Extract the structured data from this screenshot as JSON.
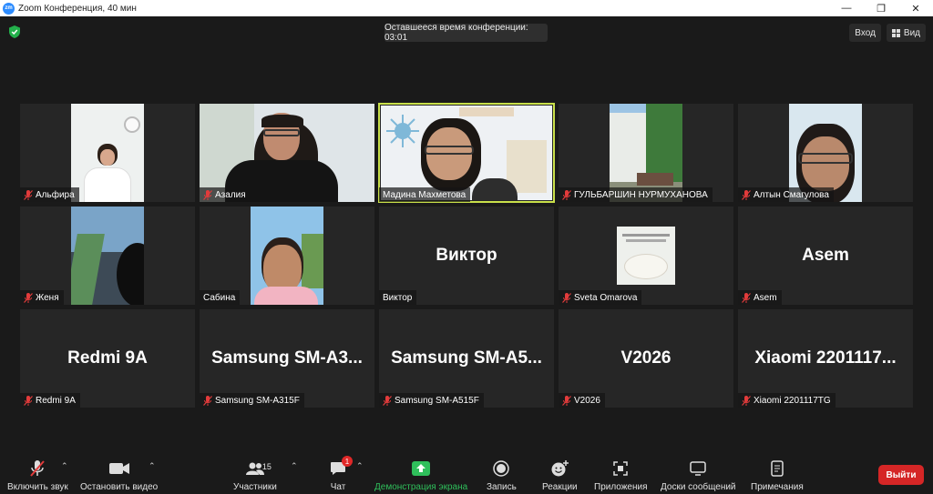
{
  "window": {
    "title": "Zoom Конференция, 40 мин",
    "logo_text": "zm",
    "minimize": "—",
    "maximize": "❐",
    "close": "✕"
  },
  "top": {
    "timer": "Оставшееся время конференции: 03:01",
    "enter": "Вход",
    "view": "Вид"
  },
  "participants": [
    {
      "name": "Альфира",
      "muted": true,
      "kind": "video"
    },
    {
      "name": "Азалия",
      "muted": true,
      "kind": "video"
    },
    {
      "name": "Мадина Махметова",
      "muted": false,
      "kind": "video",
      "active": true
    },
    {
      "name": "ГУЛЬБАРШИН НУРМУХАНОВА",
      "muted": true,
      "kind": "video"
    },
    {
      "name": "Алтын Смагулова",
      "muted": true,
      "kind": "video"
    },
    {
      "name": "Женя",
      "muted": true,
      "kind": "video"
    },
    {
      "name": "Сабина",
      "muted": false,
      "kind": "video"
    },
    {
      "name": "Виктор",
      "muted": false,
      "kind": "text",
      "big": "Виктор"
    },
    {
      "name": "Sveta Omarova",
      "muted": true,
      "kind": "video"
    },
    {
      "name": "Asem",
      "muted": true,
      "kind": "text",
      "big": "Asem"
    },
    {
      "name": "Redmi 9A",
      "muted": true,
      "kind": "text",
      "big": "Redmi 9A"
    },
    {
      "name": "Samsung SM-A315F",
      "muted": true,
      "kind": "text",
      "big": "Samsung  SM-A3..."
    },
    {
      "name": "Samsung SM-A515F",
      "muted": true,
      "kind": "text",
      "big": "Samsung  SM-A5..."
    },
    {
      "name": "V2026",
      "muted": true,
      "kind": "text",
      "big": "V2026"
    },
    {
      "name": "Xiaomi 2201117TG",
      "muted": true,
      "kind": "text",
      "big": "Xiaomi  2201117..."
    }
  ],
  "toolbar": {
    "audio": "Включить звук",
    "video": "Остановить видео",
    "participants": "Участники",
    "participants_count": "15",
    "chat": "Чат",
    "chat_badge": "1",
    "share": "Демонстрация экрана",
    "record": "Запись",
    "reactions": "Реакции",
    "apps": "Приложения",
    "whiteboards": "Доски сообщений",
    "notes": "Примечания",
    "leave": "Выйти"
  },
  "colors": {
    "share_accent": "#2fbf5b",
    "leave": "#d52626",
    "active_border": "#c9e04a",
    "mute_red": "#e23b3b"
  }
}
